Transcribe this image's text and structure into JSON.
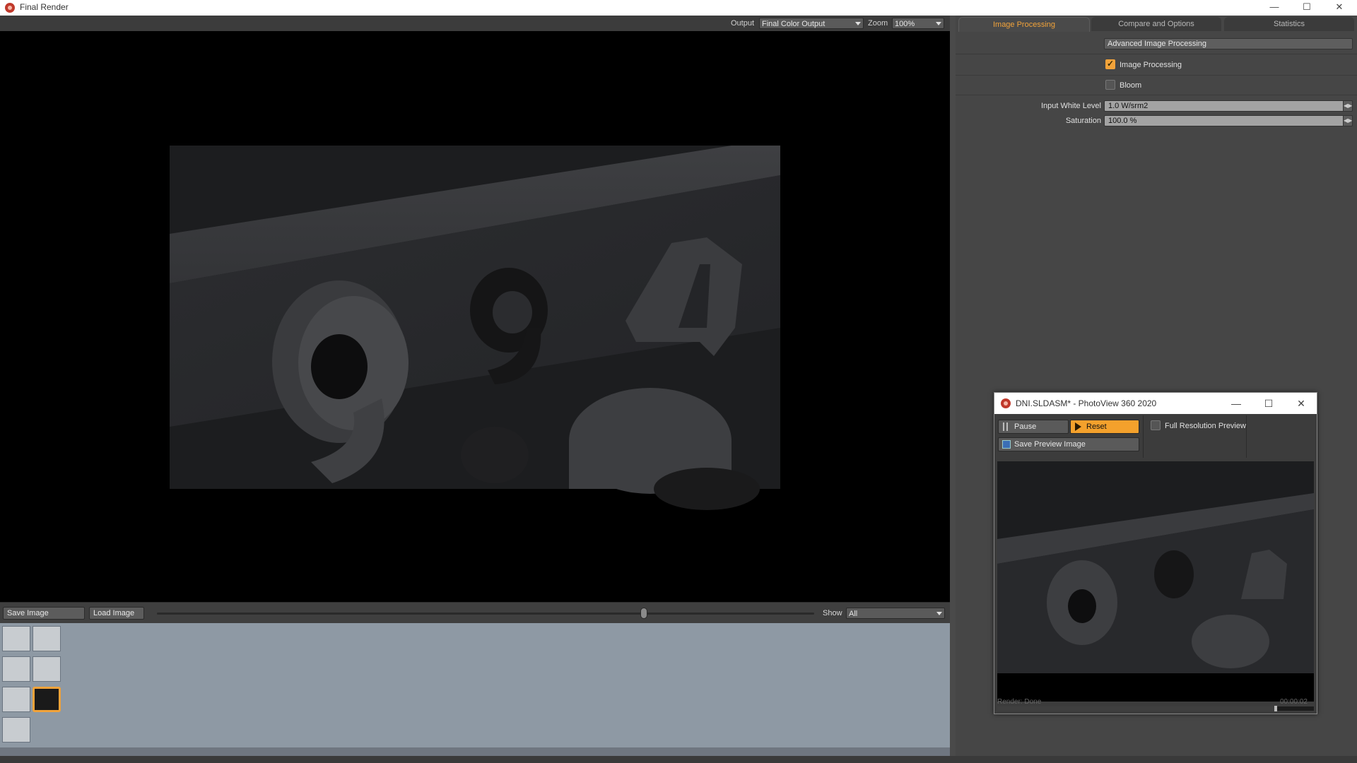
{
  "window": {
    "title": "Final Render"
  },
  "toolbar": {
    "output_label": "Output",
    "output_value": "Final Color Output",
    "zoom_label": "Zoom",
    "zoom_value": "100%"
  },
  "bottom": {
    "save_image": "Save Image",
    "load_image": "Load Image",
    "show_label": "Show",
    "show_value": "All"
  },
  "tabs": [
    {
      "label": "Image Processing",
      "active": true
    },
    {
      "label": "Compare and Options",
      "active": false
    },
    {
      "label": "Statistics",
      "active": false
    }
  ],
  "panel": {
    "advanced_button": "Advanced Image Processing",
    "image_processing_label": "Image Processing",
    "image_processing_checked": true,
    "bloom_label": "Bloom",
    "bloom_checked": false,
    "input_white_level_label": "Input White Level",
    "input_white_level_value": "1.0 W/srm2",
    "saturation_label": "Saturation",
    "saturation_value": "100.0 %"
  },
  "dialog": {
    "title": "DNI.SLDASM* - PhotoView 360 2020",
    "pause_label": "Pause",
    "reset_label": "Reset",
    "full_res_label": "Full Resolution Preview",
    "full_res_checked": false,
    "save_preview_label": "Save Preview Image",
    "status_text": "Render: Done",
    "elapsed": "00:00:02"
  },
  "colors": {
    "accent": "#f2a33a",
    "panel_bg": "#464646",
    "viewport_bg": "#000000",
    "thumb_strip": "#8e99a4"
  }
}
